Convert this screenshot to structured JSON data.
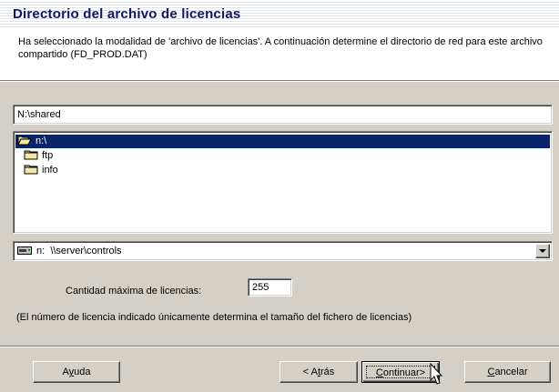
{
  "header": {
    "title": "Directorio del archivo de licencias",
    "description": "Ha seleccionado la modalidad de 'archivo de licencias'. A continuación determine el directorio de red para este archivo compartido (FD_PROD.DAT)"
  },
  "path_field": {
    "value": "N:\\shared"
  },
  "directory_list": {
    "items": [
      {
        "label": "n:\\",
        "icon": "open-folder-icon",
        "selected": true
      },
      {
        "label": "ftp",
        "icon": "folder-icon",
        "selected": false
      },
      {
        "label": "info",
        "icon": "folder-icon",
        "selected": false
      }
    ]
  },
  "drive_select": {
    "drive": "n:",
    "path": "\\\\server\\controls",
    "icon": "network-drive-icon"
  },
  "max_licenses": {
    "label": "Cantidad máxima de licencias:",
    "value": "255"
  },
  "note": "(El número de licencia indicado únicamente determina el tamaño del fichero de licencias)",
  "buttons": {
    "help": {
      "before": "A",
      "mnemonic": "y",
      "after": "uda"
    },
    "back": {
      "before": "< A",
      "mnemonic": "t",
      "after": "rás"
    },
    "continue": {
      "before": "",
      "mnemonic": "C",
      "after": "ontinuar>"
    },
    "cancel": {
      "before": "",
      "mnemonic": "C",
      "after": "ancelar"
    }
  },
  "colors": {
    "title": "#0a1a66",
    "selection": "#0a246a",
    "face": "#d4d0c8"
  }
}
